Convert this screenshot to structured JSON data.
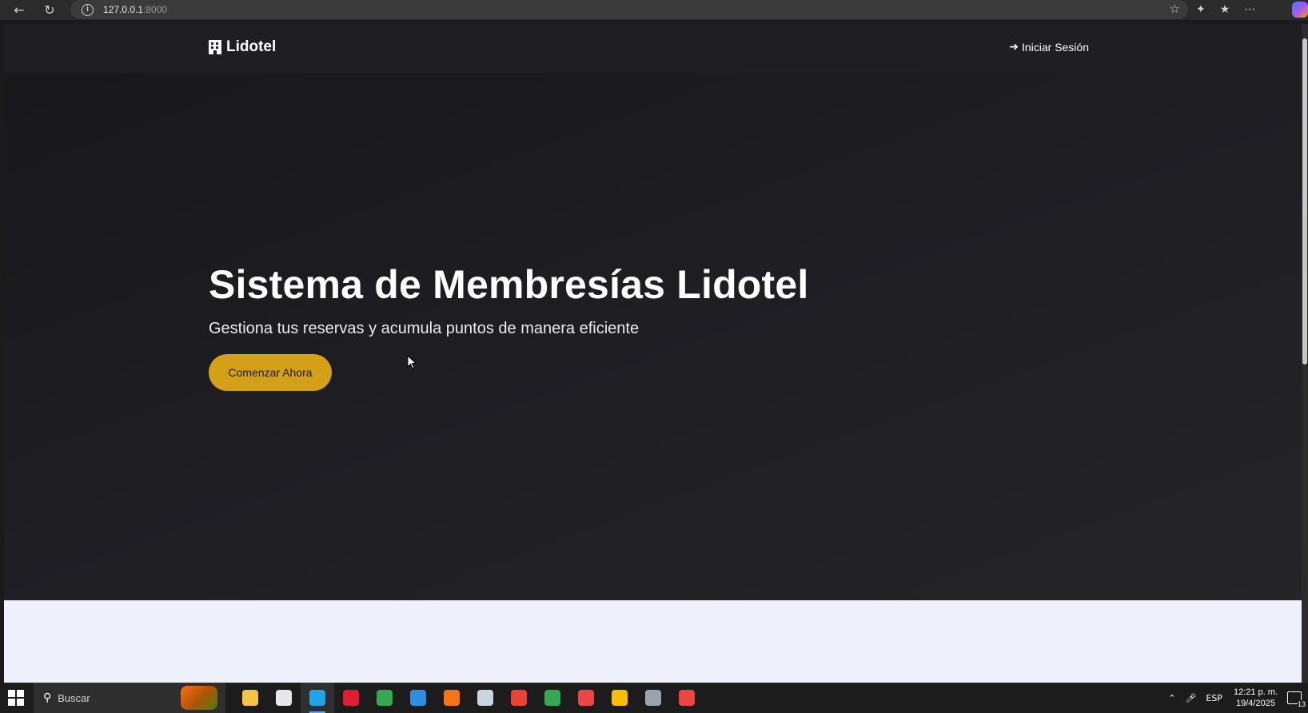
{
  "browser": {
    "url_host": "127.0.0.1",
    "url_port": ":8000",
    "icons": {
      "back": "arrow-left",
      "reload": "reload",
      "info": "info",
      "favorite": "star",
      "extensions": "puzzle",
      "collections": "star-list",
      "more": "ellipsis"
    }
  },
  "site_nav": {
    "brand": "Lidotel",
    "brand_icon": "building",
    "login_label": "Iniciar Sesión",
    "login_icon": "sign-in"
  },
  "hero": {
    "title": "Sistema de Membresías Lidotel",
    "subtitle": "Gestiona tus reservas y acumula puntos de manera eficiente",
    "cta_label": "Comenzar Ahora",
    "cta_color": "#d4a017"
  },
  "taskbar": {
    "search_placeholder": "Buscar",
    "apps": [
      {
        "name": "file-explorer",
        "color": "#f4c542"
      },
      {
        "name": "microsoft-store",
        "color": "#e5e7eb"
      },
      {
        "name": "edge",
        "color": "#22a3e6",
        "active": true
      },
      {
        "name": "opera",
        "color": "#e11d2e"
      },
      {
        "name": "chrome",
        "color": "#34a853"
      },
      {
        "name": "vscode",
        "color": "#2f8fde"
      },
      {
        "name": "app-lightning",
        "color": "#f97316"
      },
      {
        "name": "app-cloud",
        "color": "#cbd5e1"
      },
      {
        "name": "chrome-profile-1",
        "color": "#ea4335"
      },
      {
        "name": "chrome-profile-2",
        "color": "#34a853"
      },
      {
        "name": "app-red",
        "color": "#ef4444"
      },
      {
        "name": "chrome-profile-3",
        "color": "#fbbc05"
      },
      {
        "name": "app-terminal",
        "color": "#9ca3af"
      },
      {
        "name": "app-clock",
        "color": "#ef4444"
      }
    ],
    "tray": {
      "language": "ESP",
      "time": "12:21 p. m.",
      "date": "19/4/2025",
      "notification_count": "13"
    }
  }
}
